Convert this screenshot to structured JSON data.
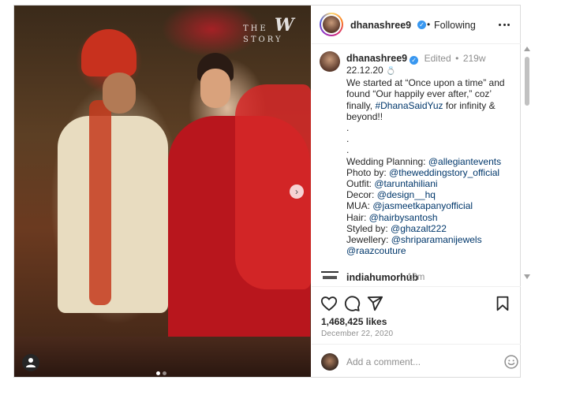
{
  "photo": {
    "watermark_left": "THE",
    "watermark_logo": "W",
    "watermark_right": "STORY"
  },
  "post_header": {
    "username": "dhanashree9",
    "separator": "•",
    "follow_status": "Following",
    "verified_icon": "verified-badge-icon",
    "more_icon": "more-options-icon"
  },
  "caption": {
    "username": "dhanashree9",
    "edited": "Edited",
    "dot": "•",
    "age": "219w",
    "date_line": "22.12.20",
    "ring_emoji": "💍",
    "text_lines": [
      "We started at “Once upon a time” and",
      "found “Our happily ever after,” coz’",
      "finally, "
    ],
    "hashtag": "#DhanaSaidYuz",
    "after_hashtag": " for infinity &",
    "beyond": "beyond!!",
    "dots": [
      ".",
      ".",
      "."
    ],
    "credits": [
      {
        "label": "Wedding Planning: ",
        "handle": "@allegiantevents"
      },
      {
        "label": "Photo by: ",
        "handle": "@theweddingstory_official"
      },
      {
        "label": "Outfit: ",
        "handle": "@taruntahiliani"
      },
      {
        "label": "Decor: ",
        "handle": "@design__hq"
      },
      {
        "label": "MUA: ",
        "handle": "@jasmeetkapanyofficial"
      },
      {
        "label": "Hair: ",
        "handle": "@hairbysantosh"
      },
      {
        "label": "Styled by: ",
        "handle": "@ghazalt222"
      },
      {
        "label": "Jewellery: ",
        "handle": "@shriparamanijewels"
      },
      {
        "label": "",
        "handle": "@raazcouture"
      }
    ]
  },
  "next_comment": {
    "username": "indiahumorhub",
    "age": "13m"
  },
  "actions": {
    "like_icon": "heart-icon",
    "comment_icon": "comment-icon",
    "share_icon": "share-icon",
    "save_icon": "bookmark-icon",
    "likes": "1,468,425 likes",
    "date": "December 22, 2020"
  },
  "comment_box": {
    "placeholder": "Add a comment...",
    "emoji_icon": "emoji-icon"
  },
  "colors": {
    "link": "#00376b",
    "verified": "#3897f0",
    "muted": "#8e8e8e",
    "text": "#262626"
  }
}
